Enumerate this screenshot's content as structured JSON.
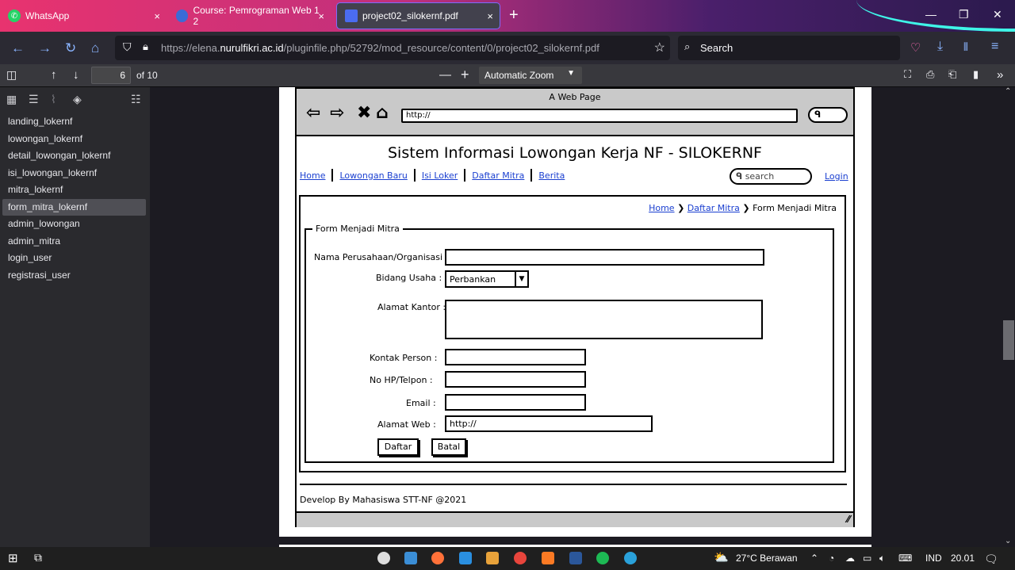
{
  "browser": {
    "tabs": [
      {
        "label": "WhatsApp",
        "icon": "whatsapp-icon"
      },
      {
        "label": "Course: Pemrograman Web 1 2",
        "icon": "moodle-icon"
      },
      {
        "label": "project02_silokernf.pdf",
        "icon": "pdf-icon",
        "active": true
      }
    ],
    "url_prefix": "https://elena.",
    "url_domain": "nurulfikri.ac.id",
    "url_rest": "/pluginfile.php/52792/mod_resource/content/0/project02_silokernf.pdf",
    "search_placeholder": "Search"
  },
  "pdf_toolbar": {
    "page_number": "6",
    "page_count": "of 10",
    "zoom": "Automatic Zoom"
  },
  "sidebar": {
    "items": [
      "landing_lokernf",
      "lowongan_lokernf",
      "detail_lowongan_lokernf",
      "isi_lowongan_lokernf",
      "mitra_lokernf",
      "form_mitra_lokernf",
      "admin_lowongan",
      "admin_mitra",
      "login_user",
      "registrasi_user"
    ],
    "selected_index": 5
  },
  "mockup": {
    "caption": "A Web Page",
    "url": "http://",
    "site_title": "Sistem Informasi Lowongan Kerja NF - SILOKERNF",
    "menu": [
      "Home",
      "Lowongan Baru",
      "Isi Loker",
      "Daftar Mitra",
      "Berita"
    ],
    "search_placeholder": "search",
    "login": "Login",
    "breadcrumb": {
      "home": "Home",
      "mitra": "Daftar Mitra",
      "current": "Form Menjadi Mitra"
    },
    "form_title": "Form Menjadi Mitra",
    "labels": {
      "nama": "Nama Perusahaan/Organisasi :",
      "bidang": "Bidang Usaha :",
      "alamat": "Alamat Kantor :",
      "kontak": "Kontak Person :",
      "hp": "No HP/Telpon :",
      "email": "Email :",
      "web": "Alamat Web :"
    },
    "bidang_value": "Perbankan",
    "web_value": "http://",
    "buttons": {
      "daftar": "Daftar",
      "batal": "Batal"
    },
    "footer": "Develop By Mahasiswa STT-NF @2021"
  },
  "taskbar": {
    "weather": "27°C  Berawan",
    "lang": "IND",
    "time": "20.01"
  }
}
